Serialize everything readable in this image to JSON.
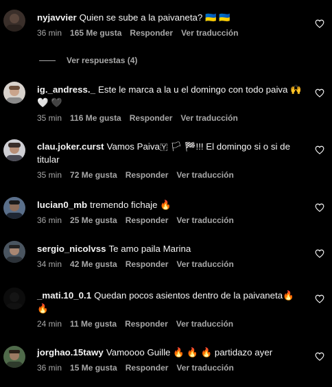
{
  "comments": [
    {
      "username": "nyjavvier",
      "text": "Quien se sube a la paivaneta? 🇺🇦 🇺🇦",
      "time": "36 min",
      "likes": "165 Me gusta",
      "reply": "Responder",
      "translate": "Ver traducción"
    },
    {
      "username": "ig._andress._",
      "text": "Este le marca a la u el domingo con todo paiva 🙌 🤍 🖤",
      "time": "35 min",
      "likes": "116 Me gusta",
      "reply": "Responder",
      "translate": "Ver traducción"
    },
    {
      "username": "clau.joker.curst",
      "text": "Vamos Paiva🇾 🏳 🏁!!! El domingo si o si de titular",
      "time": "35 min",
      "likes": "72 Me gusta",
      "reply": "Responder",
      "translate": "Ver traducción"
    },
    {
      "username": "lucian0_mb",
      "text": "tremendo fichaje 🔥",
      "time": "36 min",
      "likes": "25 Me gusta",
      "reply": "Responder",
      "translate": "Ver traducción"
    },
    {
      "username": "sergio_nicolvss",
      "text": "Te amo paila Marina",
      "time": "34 min",
      "likes": "42 Me gusta",
      "reply": "Responder",
      "translate": "Ver traducción"
    },
    {
      "username": "_mati.10_0.1",
      "text": "Quedan pocos asientos dentro de la paivaneta🔥 🔥",
      "time": "24 min",
      "likes": "11 Me gusta",
      "reply": "Responder",
      "translate": "Ver traducción"
    },
    {
      "username": "jorghao.15tawy",
      "text": "Vamoooo Guille 🔥 🔥 🔥 partidazo ayer",
      "time": "36 min",
      "likes": "15 Me gusta",
      "reply": "Responder",
      "translate": "Ver traducción"
    }
  ],
  "view_replies": "Ver respuestas (4)",
  "colors": {
    "background": "#000000",
    "text": "#f5f5f5",
    "secondary": "#a8a8a8"
  },
  "icons": {
    "like": "heart-outline-icon",
    "flag_ukraine": "flag-ukraine-icon",
    "fire": "fire-icon",
    "raised_hands": "raised-hands-icon",
    "white_heart": "white-heart-icon",
    "black_heart": "black-heart-icon"
  }
}
